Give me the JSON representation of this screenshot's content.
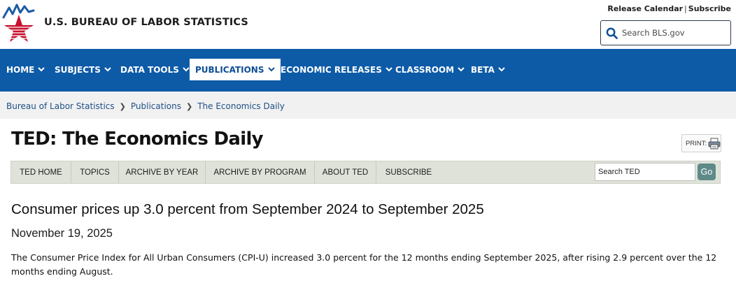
{
  "header": {
    "agency_name": "U.S. BUREAU OF LABOR STATISTICS",
    "release_calendar": "Release Calendar",
    "separator": "|",
    "subscribe": "Subscribe",
    "search_placeholder": "Search BLS.gov"
  },
  "nav": {
    "items": [
      {
        "label": "HOME"
      },
      {
        "label": "SUBJECTS"
      },
      {
        "label": "DATA TOOLS"
      },
      {
        "label": "PUBLICATIONS"
      },
      {
        "label": "ECONOMIC RELEASES"
      },
      {
        "label": "CLASSROOM"
      },
      {
        "label": "BETA"
      }
    ],
    "active": "PUBLICATIONS"
  },
  "breadcrumb": [
    "Bureau of Labor Statistics",
    "Publications",
    "The Economics Daily"
  ],
  "page_title": "TED: The Economics Daily",
  "print_label": "PRINT:",
  "ted_nav": {
    "tabs": [
      "TED HOME",
      "TOPICS",
      "ARCHIVE BY YEAR",
      "ARCHIVE BY PROGRAM",
      "ABOUT TED",
      "SUBSCRIBE"
    ],
    "search_value": "Search TED",
    "go_label": "Go"
  },
  "article": {
    "headline": "Consumer prices up 3.0 percent from September 2024 to September 2025",
    "date": "November 19, 2025",
    "body": "The Consumer Price Index for All Urban Consumers (CPI-U) increased 3.0 percent for the 12 months ending September 2025, after rising 2.9 percent over the 12 months ending August."
  },
  "colors": {
    "nav_blue": "#0d5ba7",
    "logo_red": "#c8102e",
    "logo_blue": "#1d5aa6",
    "go_button": "#5f8a88"
  }
}
